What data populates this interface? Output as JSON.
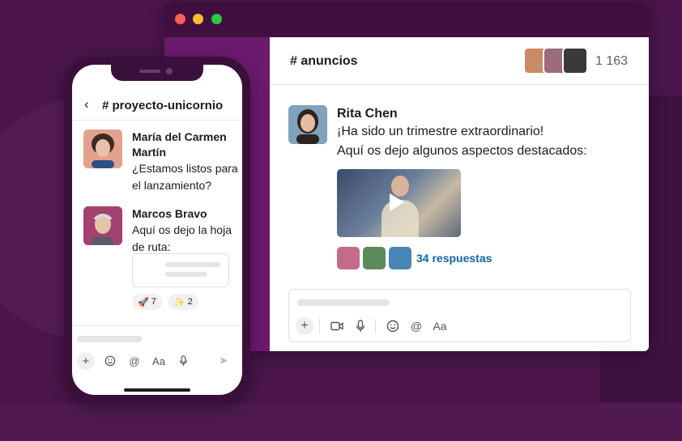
{
  "colors": {
    "brand": "#4a154b",
    "link": "#1264a3"
  },
  "desktop": {
    "channel": "# anuncios",
    "member_count": "1 163",
    "message": {
      "author": "Rita Chen",
      "line1": "¡Ha sido un trimestre extraordinario!",
      "line2": "Aquí os dejo algunos aspectos destacados:",
      "replies": "34 respuestas"
    },
    "composer_icons": [
      "plus-icon",
      "video-icon",
      "mic-icon",
      "emoji-icon",
      "mention-icon",
      "format-icon"
    ],
    "format_label": "Aa"
  },
  "phone": {
    "channel": "# proyecto-unicornio",
    "messages": [
      {
        "author": "María del Carmen Martín",
        "text": "¿Estamos listos para el lanzamiento?"
      },
      {
        "author": "Marcos Bravo",
        "text": "Aquí os dejo la hoja de ruta:"
      }
    ],
    "reactions": [
      {
        "emoji": "🚀",
        "count": "7"
      },
      {
        "emoji": "✨",
        "count": "2"
      }
    ],
    "format_label": "Aa"
  }
}
